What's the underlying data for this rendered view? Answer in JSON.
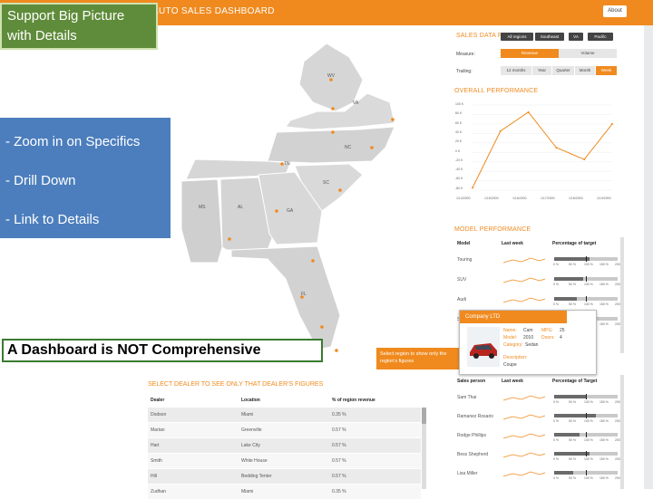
{
  "header": {
    "app_title": "AUTO SALES DASHBOARD",
    "about_label": "About"
  },
  "callouts": {
    "big_picture": "Support Big Picture with Details",
    "bullets": [
      "- Zoom in on Specifics",
      "- Drill Down",
      "- Link to Details"
    ],
    "not_comprehensive": "A Dashboard is NOT Comprehensive"
  },
  "map": {
    "state_labels": [
      "VA",
      "NC",
      "SC",
      "MS",
      "AL",
      "GA",
      "FL",
      "WV",
      "TN"
    ],
    "select_hint": "Select region to show only the region's figures"
  },
  "filters": {
    "sales_data_for": "SALES DATA FOR",
    "pills": [
      "All regions",
      "Southeast",
      "VA",
      "Pacific"
    ],
    "measure_label": "Measure:",
    "measure_options": [
      "Revenue",
      "Volume"
    ],
    "trailing_label": "Trailing:",
    "trailing_options": [
      "12 months",
      "Year",
      "Quarter",
      "Month",
      "Week"
    ]
  },
  "overall": {
    "title": "OVERALL PERFORMANCE",
    "y_ticks": [
      "100 K",
      "80 K",
      "60 K",
      "40 K",
      "20 K",
      "0 K",
      "-20 K",
      "-40 K",
      "-60 K",
      "-80 K"
    ],
    "x_ticks": [
      "1/14/2000",
      "1/15/2000",
      "1/16/2000",
      "1/17/2000",
      "1/18/2000",
      "1/19/2000"
    ]
  },
  "chart_data": {
    "type": "line",
    "x": [
      "1/14/2000",
      "1/15/2000",
      "1/16/2000",
      "1/17/2000",
      "1/18/2000",
      "1/19/2000"
    ],
    "values": [
      -75,
      45,
      85,
      10,
      -15,
      60
    ],
    "ylim": [
      -80,
      100
    ],
    "color": "#f08a1e"
  },
  "model_perf": {
    "title": "MODEL PERFORMANCE",
    "headers": [
      "Model",
      "Last week",
      "Percentage of target"
    ],
    "rows": [
      "Touring",
      "SUV",
      "Audi",
      "Sedan"
    ],
    "axis": [
      "0 %",
      "50 %",
      "100 %",
      "150 %",
      "200 %"
    ],
    "targets": [
      0.55,
      0.45,
      0.35,
      0.6
    ]
  },
  "popup": {
    "company": "Company LTD",
    "lines": [
      {
        "label": "Name:",
        "value": "Cam"
      },
      {
        "label": "Model:",
        "value": "2010"
      },
      {
        "label": "Category:",
        "value": "Sedan"
      },
      {
        "label": "Description:",
        "value": "Coupe"
      }
    ],
    "mpg_label": "MPG:",
    "doors_label": "Doors:",
    "mpg_value": "25",
    "doors_value": "4"
  },
  "sales_people": {
    "section_letter": "S",
    "headers": [
      "Sales person",
      "Last week",
      "Percentage of Target"
    ],
    "rows": [
      "Sam Thai",
      "Ramanez Rosario",
      "Rodge Phillips",
      "Bess Shepherd",
      "Lisa Miller"
    ],
    "axis": [
      "0 %",
      "50 %",
      "100 %",
      "150 %",
      "200 %"
    ],
    "targets": [
      0.5,
      0.65,
      0.4,
      0.55,
      0.3
    ]
  },
  "dealers": {
    "title": "SELECT DEALER TO SEE ONLY THAT DEALER'S FIGURES",
    "headers": [
      "Dealer",
      "Location",
      "% of region revenue"
    ],
    "rows": [
      [
        "Dodson",
        "Miami",
        "0.35 %"
      ],
      [
        "Martan",
        "Greenville",
        "0.57 %"
      ],
      [
        "Hart",
        "Lake City",
        "0.57 %"
      ],
      [
        "Smith",
        "White House",
        "0.57 %"
      ],
      [
        "Hill",
        "Bedding Tenter",
        "0.57 %"
      ],
      [
        "Zudhan",
        "Miami",
        "0.35 %"
      ]
    ]
  }
}
